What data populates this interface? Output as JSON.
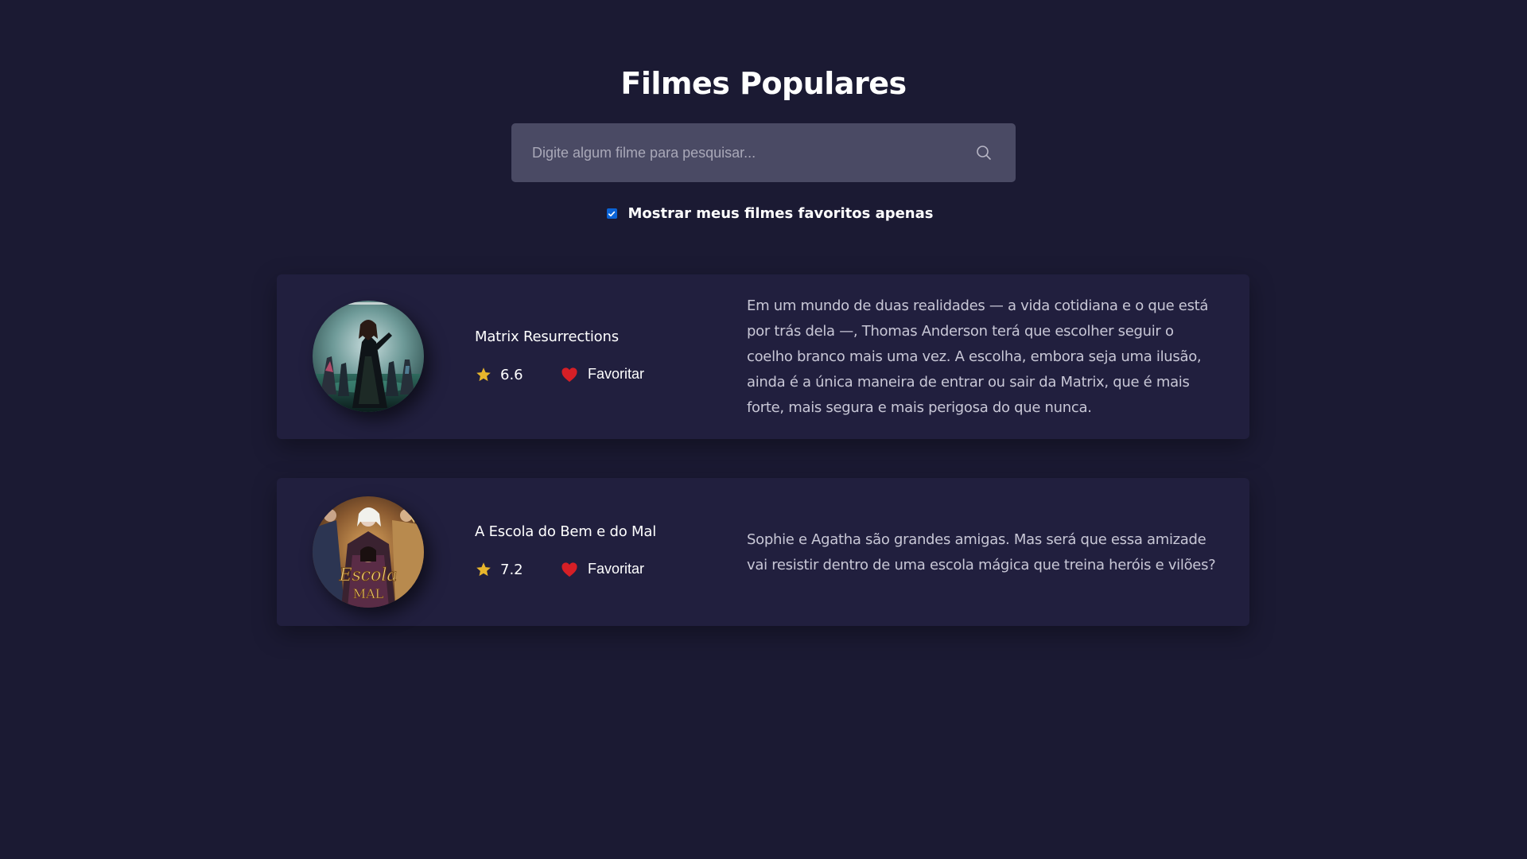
{
  "page": {
    "title": "Filmes Populares"
  },
  "search": {
    "placeholder": "Digite algum filme para pesquisar...",
    "value": "",
    "icon": "search-icon"
  },
  "filter": {
    "label": "Mostrar meus filmes favoritos apenas",
    "checked": true
  },
  "colors": {
    "background": "#1b1a33",
    "card": "#211f3e",
    "search_box": "#4a4a64",
    "star": "#e8b62c",
    "heart": "#d61f26",
    "checkbox": "#0b63d6"
  },
  "movies": [
    {
      "title": "Matrix Resurrections",
      "rating": "6.6",
      "favorite_label": "Favoritar",
      "favorited": true,
      "overview": "Em um mundo de duas realidades — a vida cotidiana e o que está por trás dela —, Thomas Anderson terá que escolher seguir o coelho branco mais uma vez. A escolha, embora seja uma ilusão, ainda é a única maneira de entrar ou sair da Matrix, que é mais forte, mais segura e mais perigosa do que nunca."
    },
    {
      "title": "A Escola do Bem e do Mal",
      "rating": "7.2",
      "favorite_label": "Favoritar",
      "favorited": true,
      "overview": "Sophie e Agatha são grandes amigas. Mas será que essa amizade vai resistir dentro de uma escola mágica que treina heróis e vilões?",
      "poster_text": "Escola"
    }
  ]
}
